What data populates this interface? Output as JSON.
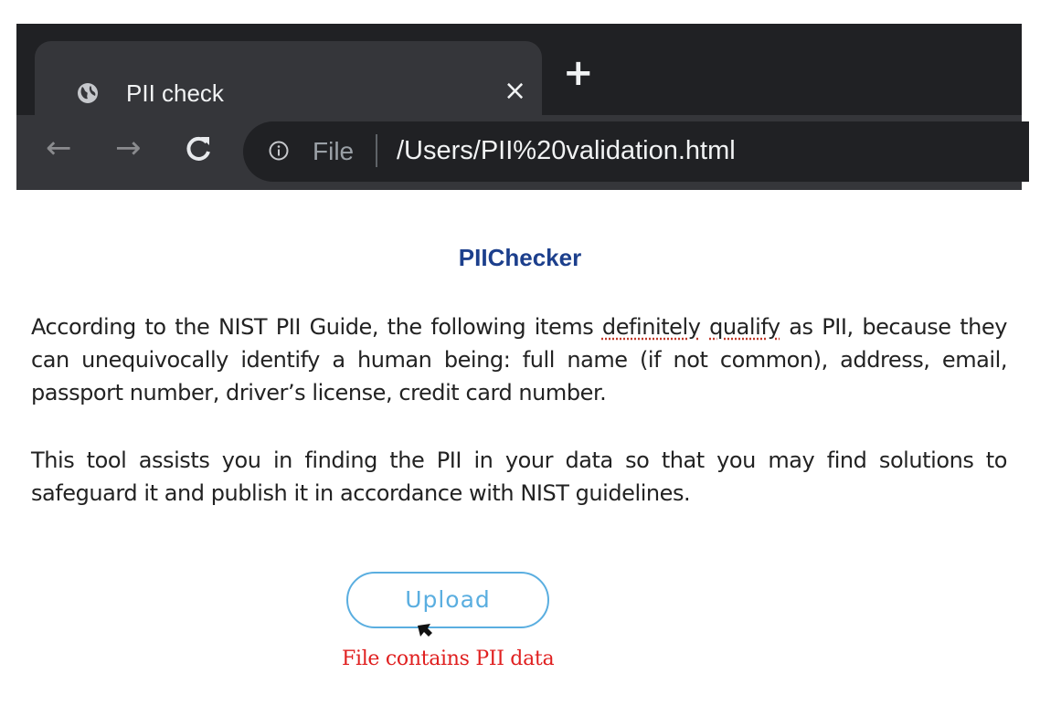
{
  "browser": {
    "tab": {
      "title": "PII check",
      "close_icon": "×",
      "favicon": "globe-icon"
    },
    "new_tab_icon": "+",
    "toolbar": {
      "back_icon": "←",
      "forward_icon": "→",
      "reload_icon": "C",
      "info_icon": "info-icon",
      "scheme_label": "File",
      "url": "/Users/PII%20validation.html"
    }
  },
  "page": {
    "title": "PIIChecker",
    "paragraph1": {
      "before": "According to the NIST PII Guide, the following items ",
      "word1": "definitely",
      "between": " ",
      "word2": "qualify",
      "after": " as PII, because they can unequivocally identify a human being: full name (if not common), address, email, passport number, driver’s license, credit card number."
    },
    "paragraph2": "This tool assists you in finding the PII in your data so that you may find solutions to safeguard it and publish it in accordance with NIST guidelines.",
    "upload_label": "Upload",
    "status_message": "File contains PII data"
  },
  "colors": {
    "title": "#1c3f8c",
    "upload_accent": "#5aaee0",
    "status_error": "#e02020",
    "chrome_dark": "#202124",
    "chrome_tab": "#35363a"
  }
}
